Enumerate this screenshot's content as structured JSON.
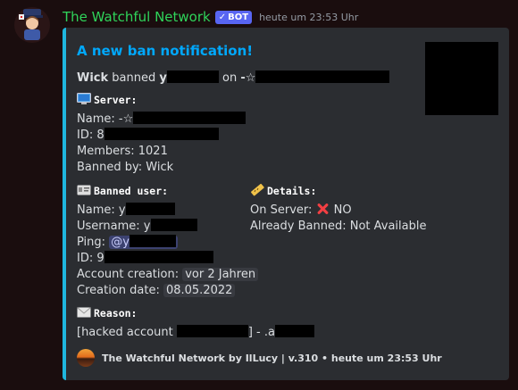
{
  "message": {
    "author": "The Watchful Network",
    "bot_badge": "BOT",
    "timestamp": "heute um 23:53 Uhr"
  },
  "embed": {
    "accent_color": "#1fb6de",
    "title": "A new ban notification!",
    "summary": {
      "actor": "Wick",
      "verb": "banned",
      "target_initial": "y",
      "on_word": "on",
      "server_prefix": "-☆"
    },
    "server": {
      "heading": "Server:",
      "name_label": "Name:",
      "name_prefix": "-☆",
      "id_label": "ID:",
      "id_prefix": "8",
      "members_text": "Members: 1021",
      "banned_by_text": "Banned by: Wick"
    },
    "banned_user": {
      "heading": "Banned user:",
      "name_label": "Name:",
      "name_prefix": "y",
      "username_label": "Username:",
      "username_prefix": "y",
      "ping_label": "Ping:",
      "ping_prefix": "@y",
      "id_label": "ID:",
      "id_prefix": "9",
      "account_creation_label": "Account creation:",
      "account_creation_value": "vor 2 Jahren",
      "creation_date_label": "Creation date:",
      "creation_date_value": "08.05.2022"
    },
    "details": {
      "heading": "Details:",
      "on_server_label": "On Server:",
      "on_server_value": "NO",
      "already_banned_text": "Already Banned: Not Available"
    },
    "reason": {
      "heading": "Reason:",
      "prefix": "[hacked account",
      "middle": "] - .a"
    },
    "footer": "The Watchful Network by IlLucy | v.310 • heute um 23:53 Uhr"
  },
  "icons": [
    "computer-icon",
    "id-card-icon",
    "ruler-icon",
    "envelope-icon",
    "cross-mark-icon",
    "checkmark-icon"
  ]
}
